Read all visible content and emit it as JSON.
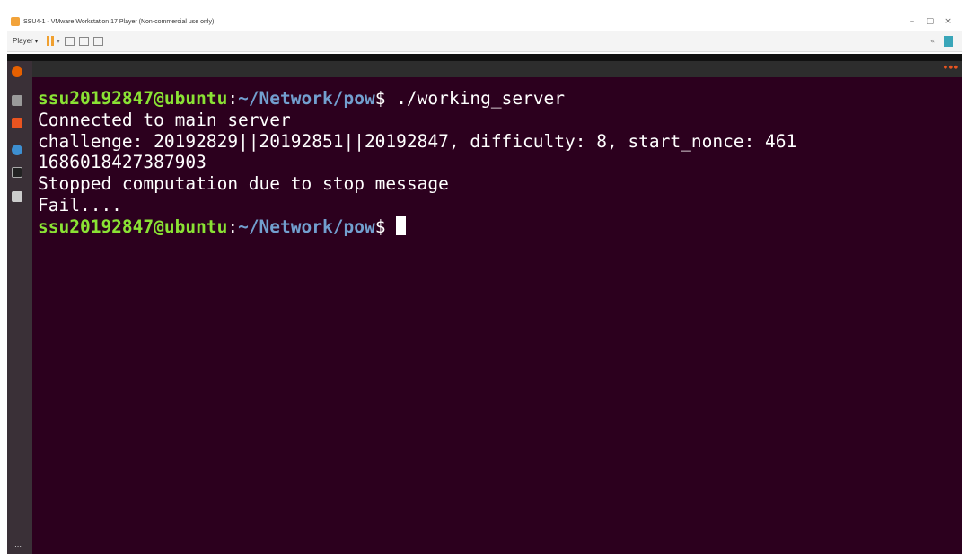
{
  "host": {
    "window_title": "SSU4-1 - VMware Workstation 17 Player (Non-commercial use only)",
    "player_menu": "Player",
    "controls": {
      "minimize": "–",
      "maximize": "▢",
      "close": "×"
    }
  },
  "guest": {
    "terminal": {
      "lines": [
        {
          "type": "prompt",
          "user": "ssu20192847@ubuntu",
          "sep": ":",
          "path": "~/Network/pow",
          "symbol": "$ ",
          "command": "./working_server"
        },
        {
          "type": "output",
          "text": "Connected to main server"
        },
        {
          "type": "output",
          "text": "challenge: 20192829||20192851||20192847, difficulty: 8, start_nonce: 461"
        },
        {
          "type": "output",
          "text": "1686018427387903"
        },
        {
          "type": "output",
          "text": "Stopped computation due to stop message"
        },
        {
          "type": "output",
          "text": "Fail...."
        },
        {
          "type": "prompt",
          "user": "ssu20192847@ubuntu",
          "sep": ":",
          "path": "~/Network/pow",
          "symbol": "$ ",
          "command": ""
        }
      ]
    },
    "dock": {
      "icons": [
        "firefox-icon",
        "files-icon",
        "software-icon",
        "help-icon",
        "terminal-icon",
        "text-editor-icon"
      ],
      "apps_label": "⋯"
    }
  }
}
